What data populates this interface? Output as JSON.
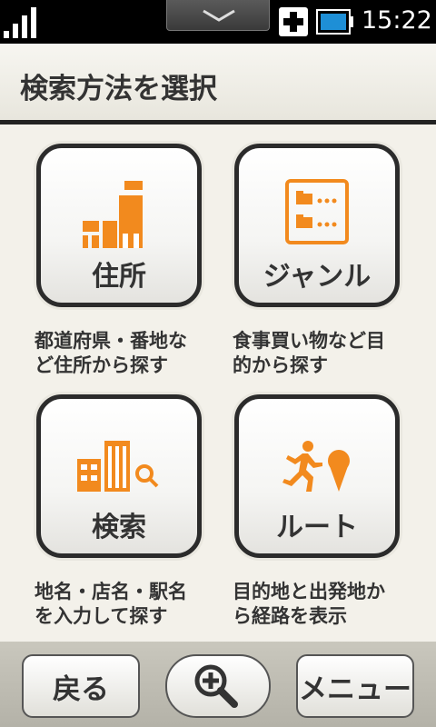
{
  "status_bar": {
    "time": "15:22",
    "icons": [
      "signal-icon",
      "notification-pull-icon",
      "plus-icon",
      "battery-icon"
    ]
  },
  "header": {
    "title": "検索方法を選択"
  },
  "options": [
    {
      "label": "住所",
      "icon": "buildings-icon",
      "desc_line1": "都道府県・番地な",
      "desc_line2": "ど住所から探す"
    },
    {
      "label": "ジャンル",
      "icon": "genre-list-icon",
      "desc_line1": "食事買い物など目",
      "desc_line2": "的から探す"
    },
    {
      "label": "検索",
      "icon": "building-search-icon",
      "desc_line1": "地名・店名・駅名",
      "desc_line2": "を入力して探す"
    },
    {
      "label": "ルート",
      "icon": "route-runner-icon",
      "desc_line1": "目的地と出発地か",
      "desc_line2": "ら経路を表示"
    }
  ],
  "bottom_bar": {
    "back_label": "戻る",
    "zoom_icon": "zoom-in-icon",
    "menu_label": "メニュー"
  },
  "colors": {
    "accent": "#f28a1e",
    "text": "#333333",
    "background": "#f3f1ea"
  }
}
